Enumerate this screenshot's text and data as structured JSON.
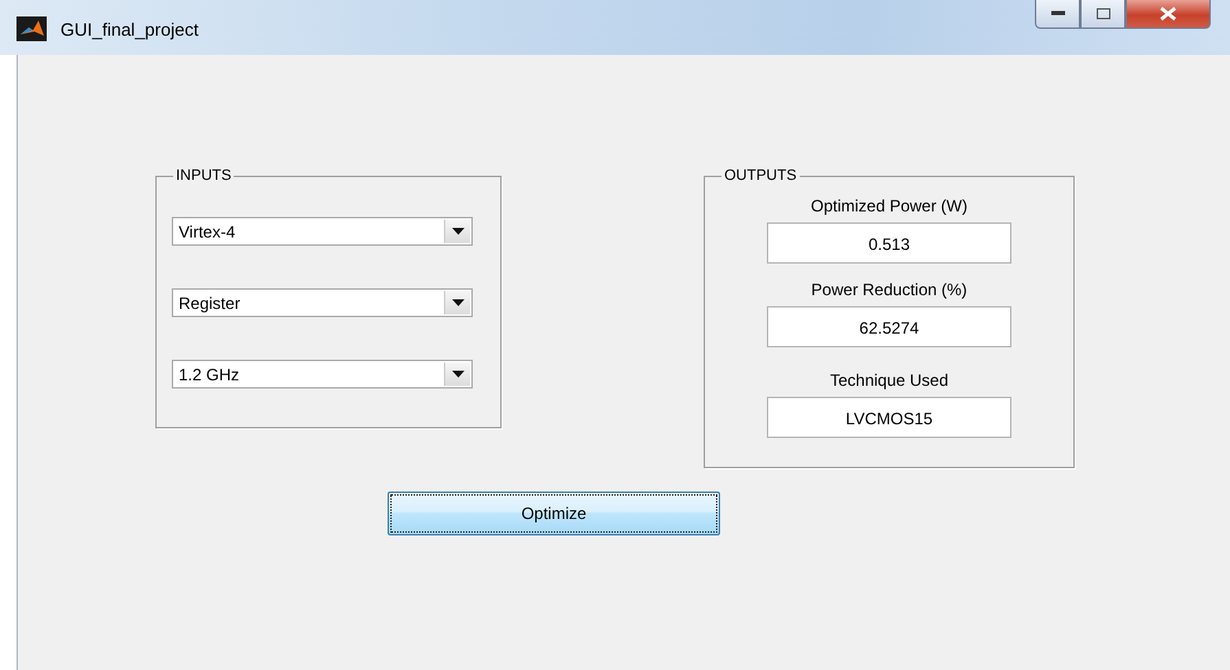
{
  "window": {
    "title": "GUI_final_project"
  },
  "inputs": {
    "title": "INPUTS",
    "dropdowns": [
      {
        "value": "Virtex-4"
      },
      {
        "value": "Register"
      },
      {
        "value": "1.2 GHz"
      }
    ]
  },
  "outputs": {
    "title": "OUTPUTS",
    "fields": [
      {
        "label": "Optimized Power (W)",
        "value": "0.513"
      },
      {
        "label": "Power Reduction (%)",
        "value": "62.5274"
      },
      {
        "label": "Technique Used",
        "value": "LVCMOS15"
      }
    ]
  },
  "button": {
    "label": "Optimize"
  }
}
